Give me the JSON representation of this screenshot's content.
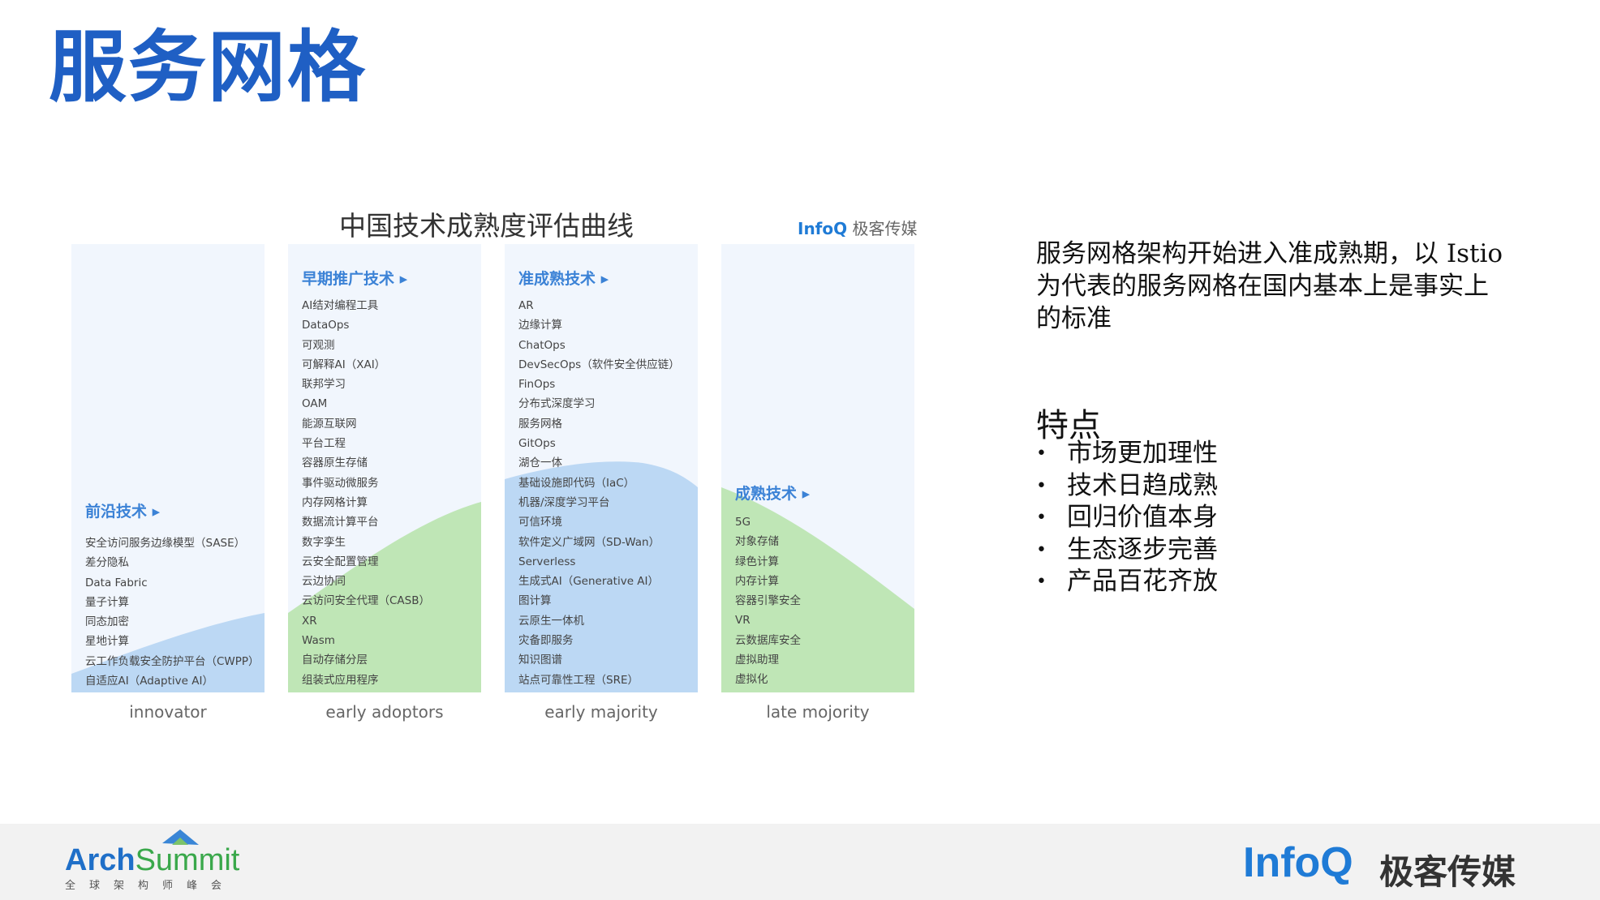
{
  "slide": {
    "title": "服务网格"
  },
  "chart": {
    "title": "中国技术成熟度评估曲线",
    "brand_info": "InfoQ",
    "brand_cn": "极客传媒",
    "columns": [
      {
        "heading": "前沿技术 ▸",
        "stage": "innovator",
        "items": [
          "安全访问服务边缘模型（SASE）",
          "差分隐私",
          "Data Fabric",
          "量子计算",
          "同态加密",
          "星地计算",
          "云工作负载安全防护平台（CWPP）",
          "自适应AI（Adaptive AI）"
        ]
      },
      {
        "heading": "早期推广技术 ▸",
        "stage": "early adoptors",
        "items": [
          "AI结对编程工具",
          "DataOps",
          "可观测",
          "可解释AI（XAI）",
          "联邦学习",
          "OAM",
          "能源互联网",
          "平台工程",
          "容器原生存储",
          "事件驱动微服务",
          "内存网格计算",
          "数据流计算平台",
          "数字孪生",
          "云安全配置管理",
          "云边协同",
          "云访问安全代理（CASB）",
          "XR",
          "Wasm",
          "自动存储分层",
          "组装式应用程序"
        ]
      },
      {
        "heading": "准成熟技术 ▸",
        "stage": "early majority",
        "items": [
          "AR",
          "边缘计算",
          "ChatOps",
          "DevSecOps（软件安全供应链）",
          "FinOps",
          "分布式深度学习",
          "服务网格",
          "GitOps",
          "湖仓一体",
          "基础设施即代码（IaC）",
          "机器/深度学习平台",
          "可信环境",
          "软件定义广域网（SD-Wan）",
          "Serverless",
          "生成式AI（Generative AI）",
          "图计算",
          "云原生一体机",
          "灾备即服务",
          "知识图谱",
          "站点可靠性工程（SRE）"
        ]
      },
      {
        "heading": "成熟技术 ▸",
        "stage": "late mojority",
        "items": [
          "5G",
          "对象存储",
          "绿色计算",
          "内存计算",
          "容器引擎安全",
          "VR",
          "云数据库安全",
          "虚拟助理",
          "虚拟化"
        ]
      }
    ]
  },
  "intro": "服务网格架构开始进入准成熟期，以 Istio 为代表的服务网格在国内基本上是事实上的标准",
  "features": {
    "title": "特点",
    "bullet": "•",
    "items": [
      "市场更加理性",
      "技术日趋成熟",
      "回归价值本身",
      "生态逐步完善",
      "产品百花齐放"
    ]
  },
  "footer": {
    "archsummit_a": "Arch",
    "archsummit_b": "Summit",
    "archsummit_sub": "全球架构师峰会",
    "infoq": "InfoQ",
    "infoq_cn": "极客传媒"
  },
  "colors": {
    "title": "#1f5fc4",
    "blue_fill": "#bcd8f4",
    "green_fill": "#bfe6b6",
    "panel": "#f1f6fd"
  }
}
